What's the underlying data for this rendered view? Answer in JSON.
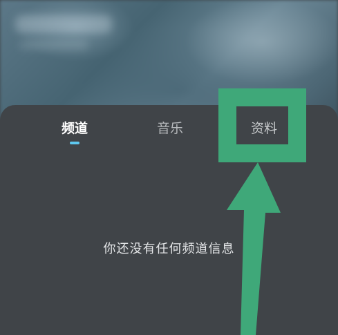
{
  "tabs": [
    {
      "label": "频道",
      "active": true
    },
    {
      "label": "音乐",
      "active": false
    },
    {
      "label": "资料",
      "active": false
    }
  ],
  "empty_state": {
    "message": "你还没有任何频道信息"
  },
  "colors": {
    "panel": "#404448",
    "active_tab_indicator": "#5ec8ef",
    "annotation_green": "#3fa879"
  },
  "annotation": {
    "highlighted_item": "资料",
    "shape": "box-with-arrow"
  }
}
